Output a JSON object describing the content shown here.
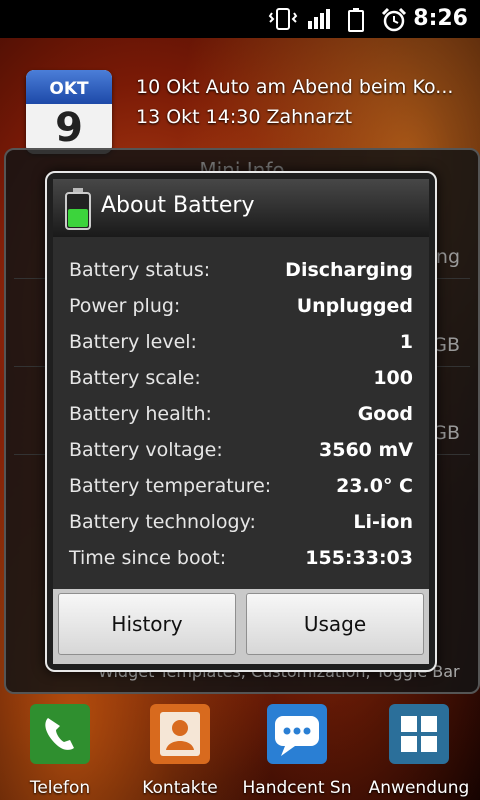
{
  "status_bar": {
    "time": "8:26",
    "icons": [
      "vibrate-icon",
      "signal-icon",
      "battery-icon",
      "alarm-icon"
    ]
  },
  "calendar_widget": {
    "month": "OKT",
    "day": "9",
    "events": [
      "10 Okt Auto am Abend beim Ko...",
      "13 Okt 14:30 Zahnarzt"
    ]
  },
  "mini_info": {
    "title": "Mini Info",
    "row_values": [
      "Discharging",
      "2.0GB",
      "5GB"
    ],
    "footer": "Widget Templates, Customization, Toggle Bar"
  },
  "dialog": {
    "title": "About Battery",
    "rows": [
      {
        "label": "Battery status:",
        "value": "Discharging"
      },
      {
        "label": "Power plug:",
        "value": "Unplugged"
      },
      {
        "label": "Battery level:",
        "value": "1"
      },
      {
        "label": "Battery scale:",
        "value": "100"
      },
      {
        "label": "Battery health:",
        "value": "Good"
      },
      {
        "label": "Battery voltage:",
        "value": "3560 mV"
      },
      {
        "label": "Battery temperature:",
        "value": "23.0° C"
      },
      {
        "label": "Battery technology:",
        "value": "Li-ion"
      },
      {
        "label": "Time since boot:",
        "value": "155:33:03"
      }
    ],
    "buttons": {
      "history": "History",
      "usage": "Usage"
    }
  },
  "dock": [
    {
      "label": "Telefon",
      "icon": "phone-icon",
      "color": "#2f8f2f"
    },
    {
      "label": "Kontakte",
      "icon": "contacts-icon",
      "color": "#d86a1e"
    },
    {
      "label": "Handcent Sn",
      "icon": "sms-icon",
      "color": "#2a7fd4"
    },
    {
      "label": "Anwendung",
      "icon": "apps-icon",
      "color": "#2b6f9a"
    }
  ],
  "colors": {
    "accent_green": "#3cd43c",
    "dialog_bg": "#2e2e2e"
  }
}
